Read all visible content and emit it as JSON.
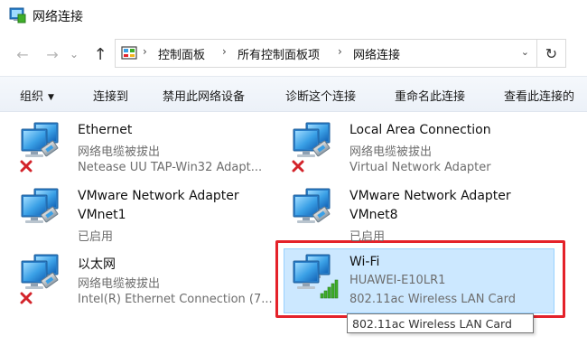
{
  "window": {
    "title": "网络连接"
  },
  "nav": {
    "back_glyph": "←",
    "forward_glyph": "→",
    "history_glyph": "⌄",
    "up_glyph": "↑",
    "refresh_glyph": "↻"
  },
  "address": {
    "crumbs": [
      "控制面板",
      "所有控制面板项",
      "网络连接"
    ],
    "separator": "›",
    "dropdown_glyph": "⌄"
  },
  "commands": {
    "organize": "组织",
    "connect_to": "连接到",
    "disable": "禁用此网络设备",
    "diagnose": "诊断这个连接",
    "rename": "重命名此连接",
    "view_status": "查看此连接的"
  },
  "connections": [
    {
      "name": "Ethernet",
      "status": "网络电缆被拔出",
      "adapter": "Netease UU TAP-Win32 Adapt...",
      "state": "unplugged"
    },
    {
      "name": "Local Area Connection",
      "status": "网络电缆被拔出",
      "adapter": "Virtual Network Adapter",
      "state": "unplugged"
    },
    {
      "name": "VMware Network Adapter VMnet1",
      "status": "已启用",
      "adapter": "",
      "state": "enabled",
      "name_line1": "VMware Network Adapter",
      "name_line2": "VMnet1"
    },
    {
      "name": "VMware Network Adapter VMnet8",
      "status": "已启用",
      "adapter": "",
      "state": "enabled",
      "name_line1": "VMware Network Adapter",
      "name_line2": "VMnet8"
    },
    {
      "name": "以太网",
      "status": "网络电缆被拔出",
      "adapter": "Intel(R) Ethernet Connection (7...",
      "state": "unplugged"
    },
    {
      "name": "Wi-Fi",
      "status": "HUAWEI-E10LR1",
      "adapter": "802.11ac Wireless LAN Card",
      "state": "connected",
      "selected": true
    }
  ],
  "tooltip": {
    "text": "802.11ac Wireless LAN Card"
  },
  "colors": {
    "selection_bg": "#cce8ff",
    "selection_border": "#99d1ff",
    "annotation_red": "#e4222a",
    "error_x": "#d3232a",
    "signal_green": "#3fae29"
  }
}
